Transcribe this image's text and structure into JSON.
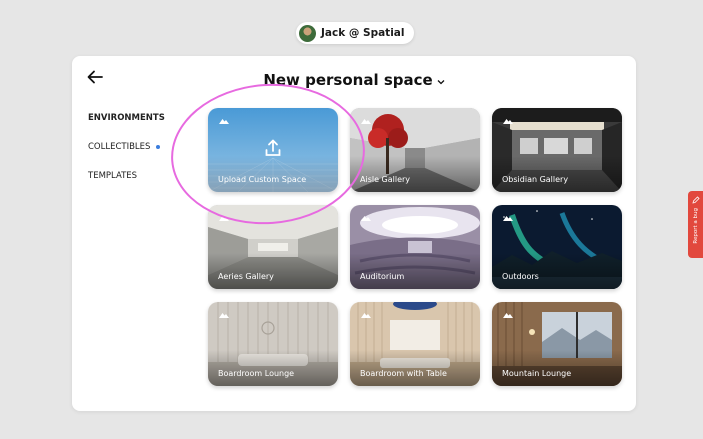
{
  "user": {
    "name": "Jack @ Spatial"
  },
  "header": {
    "title": "New personal space"
  },
  "sidebar": {
    "items": [
      {
        "label": "ENVIRONMENTS"
      },
      {
        "label": "COLLECTIBLES"
      },
      {
        "label": "TEMPLATES"
      }
    ]
  },
  "cards": [
    {
      "label": "Upload Custom Space",
      "icon": "upload-icon"
    },
    {
      "label": "Aisle Gallery"
    },
    {
      "label": "Obsidian Gallery"
    },
    {
      "label": "Aeries Gallery"
    },
    {
      "label": "Auditorium"
    },
    {
      "label": "Outdoors"
    },
    {
      "label": "Boardroom Lounge"
    },
    {
      "label": "Boardroom with Table"
    },
    {
      "label": "Mountain Lounge"
    }
  ],
  "report": {
    "label": "Report a bug"
  },
  "colors": {
    "accent": "#3b7ddd",
    "highlight_ring": "#e76ae0",
    "report": "#e2483d"
  }
}
